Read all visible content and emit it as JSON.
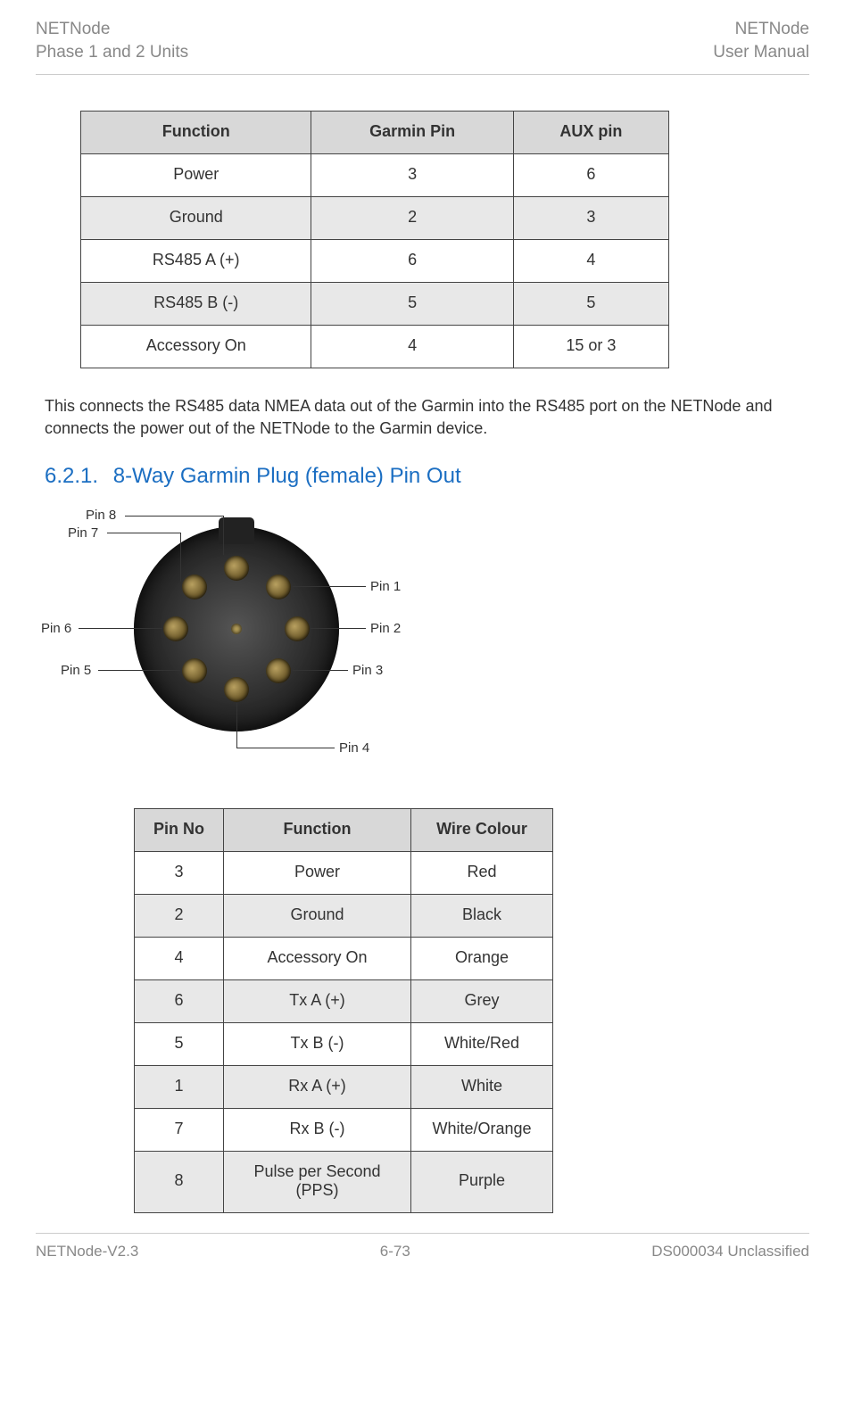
{
  "header": {
    "left_line1": "NETNode",
    "left_line2": "Phase 1 and 2 Units",
    "right_line1": "NETNode",
    "right_line2": "User Manual"
  },
  "table1": {
    "headers": [
      "Function",
      "Garmin Pin",
      "AUX pin"
    ],
    "rows": [
      [
        "Power",
        "3",
        "6"
      ],
      [
        "Ground",
        "2",
        "3"
      ],
      [
        "RS485 A (+)",
        "6",
        "4"
      ],
      [
        "RS485 B (-)",
        "5",
        "5"
      ],
      [
        "Accessory On",
        "4",
        "15 or 3"
      ]
    ]
  },
  "paragraph1": "This connects the RS485 data NMEA data out of the Garmin into the RS485 port on the NETNode and connects the power out of the NETNode to the Garmin device.",
  "section": {
    "number": "6.2.1.",
    "title": "8-Way Garmin Plug (female) Pin Out"
  },
  "diagram": {
    "labels": {
      "pin1": "Pin 1",
      "pin2": "Pin 2",
      "pin3": "Pin 3",
      "pin4": "Pin 4",
      "pin5": "Pin 5",
      "pin6": "Pin 6",
      "pin7": "Pin 7",
      "pin8": "Pin 8"
    }
  },
  "table2": {
    "headers": [
      "Pin No",
      "Function",
      "Wire Colour"
    ],
    "rows": [
      [
        "3",
        "Power",
        "Red"
      ],
      [
        "2",
        "Ground",
        "Black"
      ],
      [
        "4",
        "Accessory On",
        "Orange"
      ],
      [
        "6",
        "Tx A (+)",
        "Grey"
      ],
      [
        "5",
        "Tx B (-)",
        "White/Red"
      ],
      [
        "1",
        "Rx A (+)",
        "White"
      ],
      [
        "7",
        "Rx B (-)",
        "White/Orange"
      ],
      [
        "8",
        "Pulse per Second (PPS)",
        "Purple"
      ]
    ]
  },
  "footer": {
    "left": "NETNode-V2.3",
    "center": "6-73",
    "right": "DS000034 Unclassified"
  },
  "chart_data": [
    {
      "type": "table",
      "title": "Garmin to AUX pin mapping",
      "columns": [
        "Function",
        "Garmin Pin",
        "AUX pin"
      ],
      "rows": [
        [
          "Power",
          3,
          6
        ],
        [
          "Ground",
          2,
          3
        ],
        [
          "RS485 A (+)",
          6,
          4
        ],
        [
          "RS485 B (-)",
          5,
          5
        ],
        [
          "Accessory On",
          4,
          "15 or 3"
        ]
      ]
    },
    {
      "type": "table",
      "title": "8-Way Garmin Plug (female) Pin Out",
      "columns": [
        "Pin No",
        "Function",
        "Wire Colour"
      ],
      "rows": [
        [
          3,
          "Power",
          "Red"
        ],
        [
          2,
          "Ground",
          "Black"
        ],
        [
          4,
          "Accessory On",
          "Orange"
        ],
        [
          6,
          "Tx A (+)",
          "Grey"
        ],
        [
          5,
          "Tx B (-)",
          "White/Red"
        ],
        [
          1,
          "Rx A (+)",
          "White"
        ],
        [
          7,
          "Rx B (-)",
          "White/Orange"
        ],
        [
          8,
          "Pulse per Second (PPS)",
          "Purple"
        ]
      ]
    }
  ]
}
